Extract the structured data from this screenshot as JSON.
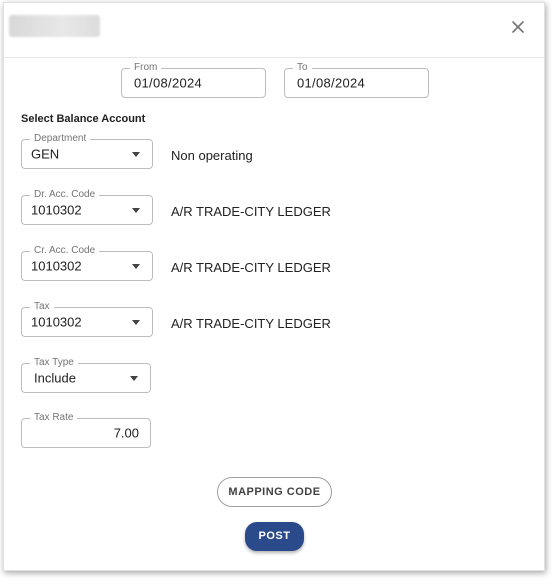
{
  "dialog": {
    "close_icon": "close-icon"
  },
  "date_range": {
    "from_label": "From",
    "from_value": "01/08/2024",
    "to_label": "To",
    "to_value": "01/08/2024"
  },
  "section": {
    "title": "Select Balance Account"
  },
  "department": {
    "label": "Department",
    "value": "GEN",
    "description": "Non operating"
  },
  "dr_acc_code": {
    "label": "Dr. Acc. Code",
    "value": "1010302",
    "description": "A/R TRADE-CITY LEDGER"
  },
  "cr_acc_code": {
    "label": "Cr. Acc. Code",
    "value": "1010302",
    "description": "A/R TRADE-CITY LEDGER"
  },
  "tax": {
    "label": "Tax",
    "value": "1010302",
    "description": "A/R TRADE-CITY LEDGER"
  },
  "tax_type": {
    "label": "Tax Type",
    "value": "Include"
  },
  "tax_rate": {
    "label": "Tax Rate",
    "value": "7.00"
  },
  "buttons": {
    "mapping_code": "MAPPING CODE",
    "post": "POST"
  },
  "colors": {
    "primary": "#2b4a8b",
    "border": "#bdbdbd"
  }
}
